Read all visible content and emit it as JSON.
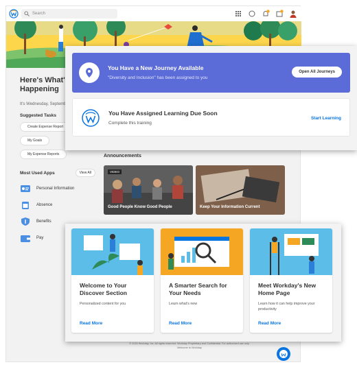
{
  "topbar": {
    "search_placeholder": "Search"
  },
  "home": {
    "greeting": "Here's What's Happening",
    "date": "It's Wednesday, Septemb"
  },
  "suggested_tasks": {
    "title": "Suggested Tasks",
    "items": [
      "Create Expense Report",
      "My Goals",
      "My Expense Reports"
    ]
  },
  "most_used_apps": {
    "title": "Most Used Apps",
    "view_all": "View All",
    "items": [
      {
        "label": "Personal Information",
        "icon": "id-card-icon"
      },
      {
        "label": "Absence",
        "icon": "calendar-icon"
      },
      {
        "label": "Benefits",
        "icon": "shield-icon"
      },
      {
        "label": "Pay",
        "icon": "wallet-icon"
      }
    ]
  },
  "announcements": {
    "title": "Announcements",
    "items": [
      {
        "label": "Good People Know Good People",
        "badge": "VIDEO"
      },
      {
        "label": "Keep Your Information Current"
      }
    ]
  },
  "journey": {
    "title": "You Have a New Journey Available",
    "subtitle": "\"Diversity and Inclusion\" has been assigned to you",
    "button": "Open All Journeys"
  },
  "learning": {
    "title": "You Have Assigned Learning Due Soon",
    "subtitle": "Complete this training",
    "button": "Start Learning"
  },
  "cards": [
    {
      "title": "Welcome to Your Discover Section",
      "desc": "Personalized content for you",
      "link": "Read More",
      "color": "#5bbde8"
    },
    {
      "title": "A Smarter Search for Your Needs",
      "desc": "Learn what's new",
      "link": "Read More",
      "color": "#f5a623"
    },
    {
      "title": "Meet Workday's New Home Page",
      "desc": "Learn how it can help improve your productivity",
      "link": "Read More",
      "color": "#5bbde8"
    }
  ],
  "footer": {
    "text": "© 2020 Workday, Inc. All rights reserved. Workday Proprietary and Confidential. For authorized use only.",
    "link": "Welcome to Workday"
  },
  "colors": {
    "accent_blue": "#0875e1",
    "journey_purple": "#5b6bd8",
    "hero_yellow": "#fdd64c"
  }
}
